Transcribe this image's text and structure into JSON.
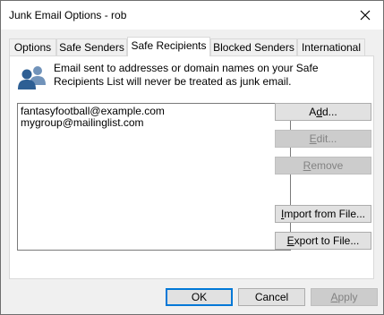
{
  "window": {
    "title": "Junk Email Options - rob"
  },
  "tabs": [
    {
      "label": "Options",
      "active": false
    },
    {
      "label": "Safe Senders",
      "active": false
    },
    {
      "label": "Safe Recipients",
      "active": true
    },
    {
      "label": "Blocked Senders",
      "active": false
    },
    {
      "label": "International",
      "active": false
    }
  ],
  "panel": {
    "icon": "people-icon",
    "description": "Email sent to addresses or domain names on your Safe Recipients List will never be treated as junk email.",
    "list_items": [
      "fantasyfootball@example.com",
      "mygroup@mailinglist.com"
    ]
  },
  "side_buttons": {
    "add": {
      "pre": "A",
      "key": "d",
      "post": "d..."
    },
    "edit": {
      "pre": "",
      "key": "E",
      "post": "dit..."
    },
    "remove": {
      "pre": "",
      "key": "R",
      "post": "emove"
    },
    "import": {
      "pre": "",
      "key": "I",
      "post": "mport from File..."
    },
    "export": {
      "pre": "",
      "key": "E",
      "post": "xport to File..."
    }
  },
  "footer": {
    "ok": "OK",
    "cancel": "Cancel",
    "apply": {
      "pre": "",
      "key": "A",
      "post": "pply"
    }
  },
  "colors": {
    "accent": "#0078d7",
    "icon_blue": "#2e5f94",
    "icon_light": "#7193ba"
  }
}
